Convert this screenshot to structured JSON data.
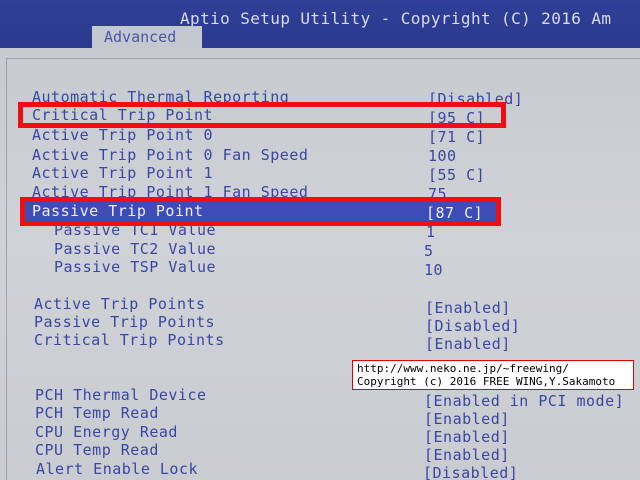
{
  "header": {
    "title": "Aptio Setup Utility - Copyright (C) 2016 Am",
    "active_tab": "Advanced"
  },
  "settings": [
    {
      "label": "Automatic Thermal Reporting",
      "value": "[Disabled]"
    },
    {
      "label": "Critical Trip Point",
      "value": "[95 C]"
    },
    {
      "label": "Active Trip Point 0",
      "value": "[71 C]"
    },
    {
      "label": "Active Trip Point 0 Fan Speed",
      "value": "100"
    },
    {
      "label": "Active Trip Point 1",
      "value": "[55 C]"
    },
    {
      "label": "Active Trip Point 1 Fan Speed",
      "value": "75"
    },
    {
      "label": "Passive Trip Point",
      "value": "[87 C]"
    },
    {
      "label": "Passive TC1 Value",
      "value": "1"
    },
    {
      "label": "Passive TC2 Value",
      "value": "5"
    },
    {
      "label": "Passive TSP Value",
      "value": "10"
    },
    {
      "label": "Active Trip Points",
      "value": "[Enabled]"
    },
    {
      "label": "Passive Trip Points",
      "value": "[Disabled]"
    },
    {
      "label": "Critical Trip Points",
      "value": "[Enabled]"
    },
    {
      "label": "PCH Thermal Device",
      "value": "[Enabled in PCI mode]"
    },
    {
      "label": "PCH Temp Read",
      "value": "[Enabled]"
    },
    {
      "label": "CPU Energy Read",
      "value": "[Enabled]"
    },
    {
      "label": "CPU Temp Read",
      "value": "[Enabled]"
    },
    {
      "label": "Alert Enable Lock",
      "value": "[Disabled]"
    }
  ],
  "watermark": {
    "line1": "http://www.neko.ne.jp/~freewing/",
    "line2": "Copyright (c) 2016 FREE WING,Y.Sakamoto"
  },
  "colors": {
    "header_bg": "#2f3f97",
    "panel_bg": "#c9ccd0",
    "text_blue": "#3b46a3",
    "highlight_bar": "#3d4cb6",
    "annotation_red": "#f10d12"
  }
}
